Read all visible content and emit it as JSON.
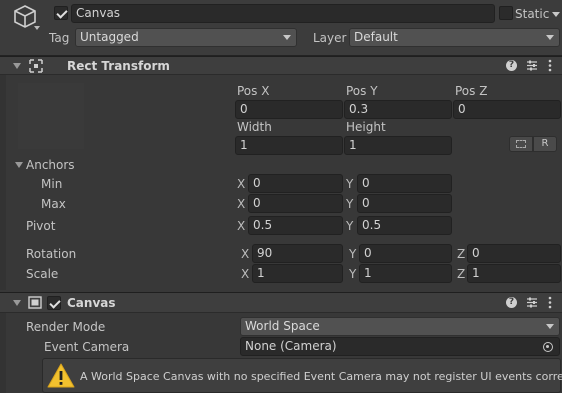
{
  "object": {
    "name": "Canvas",
    "active": true,
    "static_label": "Static",
    "static_checked": false,
    "tag_label": "Tag",
    "tag_value": "Untagged",
    "layer_label": "Layer",
    "layer_value": "Default"
  },
  "rect_transform": {
    "title": "Rect Transform",
    "pos_x_label": "Pos X",
    "pos_y_label": "Pos Y",
    "pos_z_label": "Pos Z",
    "pos_x": "0",
    "pos_y": "0.3",
    "pos_z": "0",
    "width_label": "Width",
    "height_label": "Height",
    "width": "1",
    "height": "1",
    "raw_edit_label": "R",
    "anchors_label": "Anchors",
    "min_label": "Min",
    "max_label": "Max",
    "min_x": "0",
    "min_y": "0",
    "max_x": "0",
    "max_y": "0",
    "pivot_label": "Pivot",
    "pivot_x": "0.5",
    "pivot_y": "0.5",
    "rotation_label": "Rotation",
    "rotation_x": "90",
    "rotation_y": "0",
    "rotation_z": "0",
    "scale_label": "Scale",
    "scale_x": "1",
    "scale_y": "1",
    "scale_z": "1",
    "axis_x": "X",
    "axis_y": "Y",
    "axis_z": "Z"
  },
  "canvas": {
    "title": "Canvas",
    "enabled": true,
    "render_mode_label": "Render Mode",
    "render_mode_value": "World Space",
    "event_camera_label": "Event Camera",
    "event_camera_value": "None (Camera)",
    "warning": "A World Space Canvas with no specified Event Camera may not register UI events correctly."
  },
  "icons": {
    "gameobject": "cube-icon",
    "rect_transform": "rect-transform-icon",
    "canvas": "canvas-icon",
    "help": "help-icon",
    "presets": "presets-icon",
    "menu": "kebab-menu-icon",
    "warning": "warning-icon",
    "object_picker": "object-picker-icon",
    "blueprint": "blueprint-mode-icon"
  },
  "colors": {
    "panel_bg": "#383838",
    "field_bg": "#2a2a2a",
    "warning_yellow": "#f2c12e"
  }
}
